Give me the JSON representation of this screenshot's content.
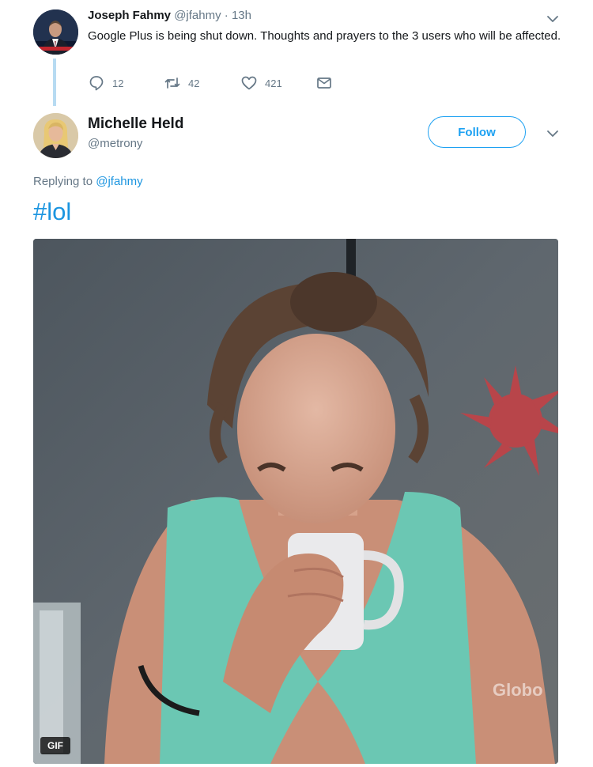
{
  "colors": {
    "accent": "#1da1f2",
    "link": "#1b95e0",
    "muted": "#657786",
    "thread_line": "#b7dbf2"
  },
  "parent_tweet": {
    "author_name": "Joseph Fahmy",
    "handle": "@jfahmy",
    "time": "· 13h",
    "text": "Google Plus is being shut down. Thoughts and prayers to the 3 users who will be affected.",
    "actions": {
      "reply_count": "12",
      "retweet_count": "42",
      "like_count": "421"
    },
    "menu_icon": "chevron-down-icon"
  },
  "reply_tweet": {
    "author_name": "Michelle Held",
    "handle": "@metrony",
    "follow_label": "Follow",
    "replying_prefix": "Replying to",
    "replying_handle": "@jfahmy",
    "text": "#lol",
    "media": {
      "badge": "GIF",
      "watermark": "Globo"
    },
    "menu_icon": "chevron-down-icon"
  }
}
